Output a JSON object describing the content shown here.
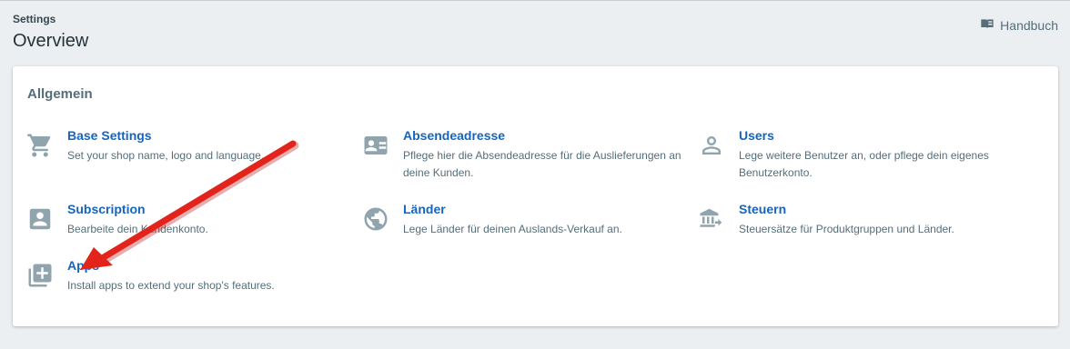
{
  "header": {
    "breadcrumb": "Settings",
    "title": "Overview",
    "handbook_label": "Handbuch"
  },
  "section": {
    "title": "Allgemein"
  },
  "items": [
    {
      "name": "Base Settings",
      "desc": "Set your shop name, logo and language.",
      "icon": "shopping-cart-icon"
    },
    {
      "name": "Absendeadresse",
      "desc": "Pflege hier die Absendeadresse für die Auslieferungen an deine Kunden.",
      "icon": "contact-card-icon"
    },
    {
      "name": "Users",
      "desc": "Lege weitere Benutzer an, oder pflege dein eigenes Benutzerkonto.",
      "icon": "person-outline-icon"
    },
    {
      "name": "Subscription",
      "desc": "Bearbeite dein Kundenkonto.",
      "icon": "account-box-icon"
    },
    {
      "name": "Länder",
      "desc": "Lege Länder für deinen Auslands-Verkauf an.",
      "icon": "globe-icon"
    },
    {
      "name": "Steuern",
      "desc": "Steuersätze für Produktgruppen und Länder.",
      "icon": "bank-transfer-icon"
    },
    {
      "name": "Apps",
      "desc": "Install apps to extend your shop's features.",
      "icon": "library-add-icon"
    }
  ],
  "colors": {
    "background": "#eceff1",
    "link": "#1565c0",
    "icon": "#90a4ae",
    "annotation_arrow": "#e3241c"
  }
}
